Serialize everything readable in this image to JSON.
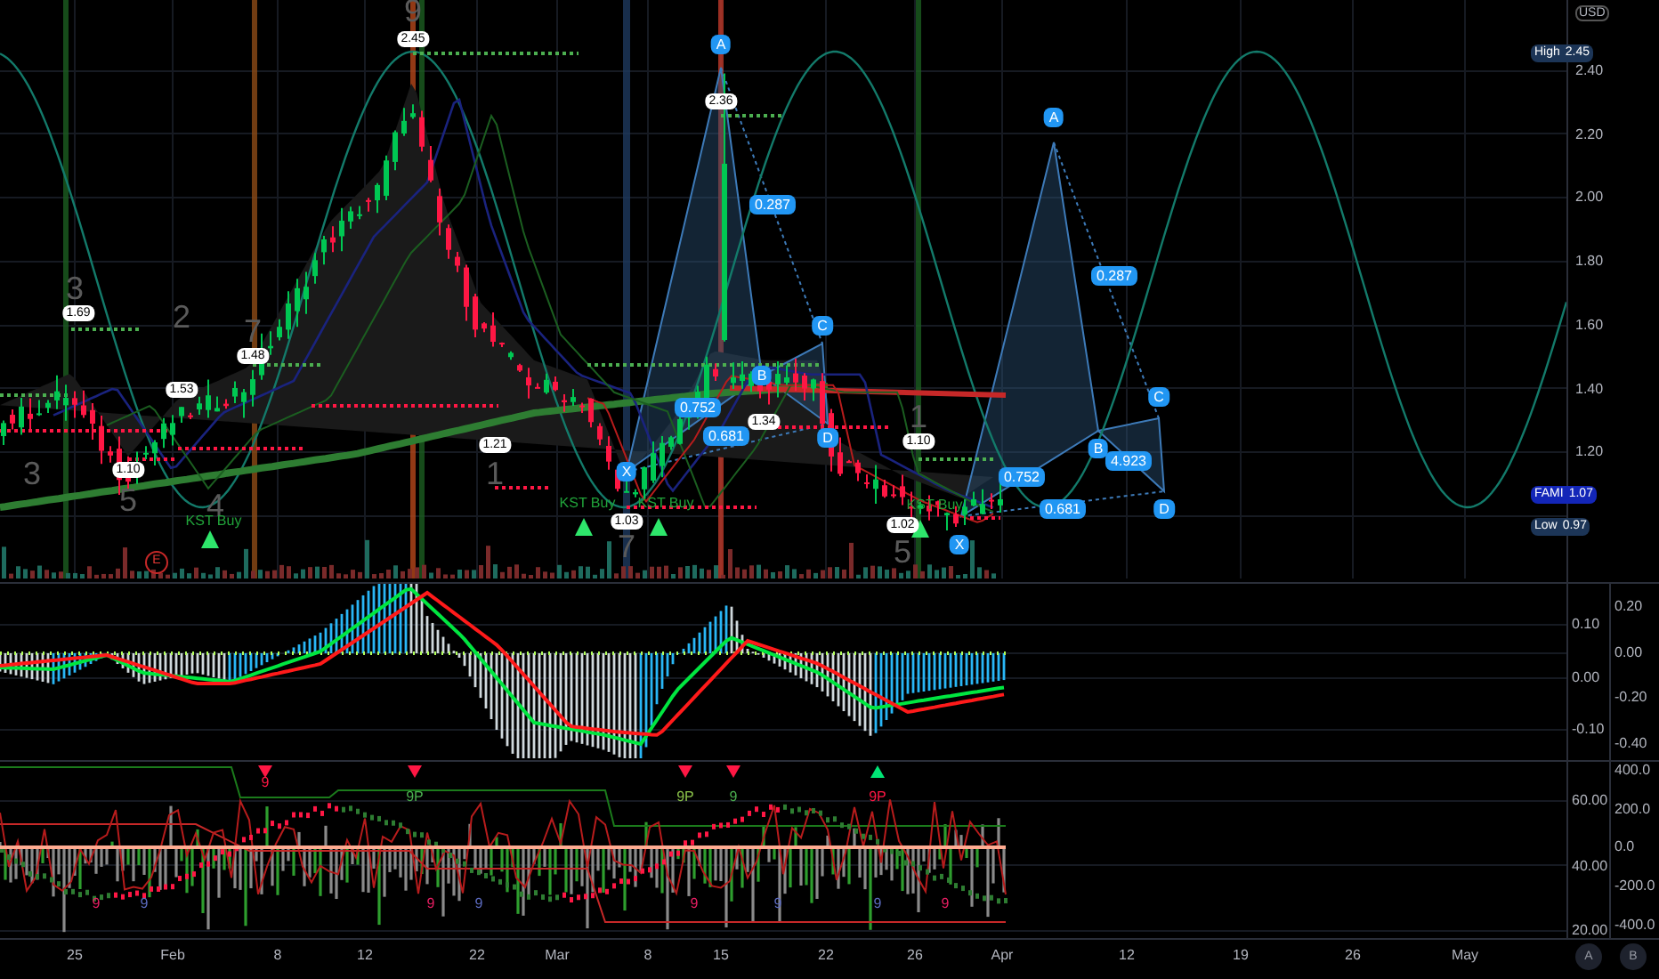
{
  "price_axis": {
    "currency": "USD",
    "ticks": [
      "2.40",
      "2.20",
      "2.00",
      "1.80",
      "1.60",
      "1.40",
      "1.20"
    ],
    "tags": [
      {
        "kind": "high",
        "label": "High",
        "value": "2.45"
      },
      {
        "kind": "last",
        "label": "FAMI",
        "value": "1.07"
      },
      {
        "kind": "low",
        "label": "Low",
        "value": "0.97"
      }
    ]
  },
  "main_annotations": [
    {
      "kind": "count",
      "text": "9"
    },
    {
      "kind": "price_tag",
      "text": "2.45"
    },
    {
      "kind": "count",
      "text": "3"
    },
    {
      "kind": "price_tag",
      "text": "1.69"
    },
    {
      "kind": "count",
      "text": "2"
    },
    {
      "kind": "price_tag",
      "text": "1.53"
    },
    {
      "kind": "count",
      "text": "7"
    },
    {
      "kind": "price_tag",
      "text": "1.48"
    },
    {
      "kind": "count",
      "text": "3"
    },
    {
      "kind": "price_tag",
      "text": "1.10"
    },
    {
      "kind": "count",
      "text": "5"
    },
    {
      "kind": "count",
      "text": "4"
    },
    {
      "kind": "signal",
      "text": "KST Buy"
    },
    {
      "kind": "price_tag",
      "text": "1.21"
    },
    {
      "kind": "count",
      "text": "1"
    },
    {
      "kind": "signal",
      "text": "KST Buy"
    },
    {
      "kind": "price_tag",
      "text": "1.03"
    },
    {
      "kind": "signal",
      "text": "KST Buy"
    },
    {
      "kind": "count",
      "text": "7"
    },
    {
      "kind": "pattern_point",
      "text": "A"
    },
    {
      "kind": "price_tag",
      "text": "2.36"
    },
    {
      "kind": "ratio",
      "text": "0.287"
    },
    {
      "kind": "pattern_point",
      "text": "C"
    },
    {
      "kind": "pattern_point",
      "text": "B"
    },
    {
      "kind": "ratio",
      "text": "0.752"
    },
    {
      "kind": "price_tag",
      "text": "1.34"
    },
    {
      "kind": "ratio",
      "text": "0.681"
    },
    {
      "kind": "pattern_point",
      "text": "D"
    },
    {
      "kind": "pattern_point",
      "text": "X"
    },
    {
      "kind": "count",
      "text": "1"
    },
    {
      "kind": "price_tag",
      "text": "1.10"
    },
    {
      "kind": "signal",
      "text": "KST Buy"
    },
    {
      "kind": "price_tag",
      "text": "1.02"
    },
    {
      "kind": "count",
      "text": "5"
    },
    {
      "kind": "pattern_point",
      "text": "X"
    },
    {
      "kind": "pattern_point",
      "text": "A"
    },
    {
      "kind": "ratio",
      "text": "0.287"
    },
    {
      "kind": "pattern_point",
      "text": "C"
    },
    {
      "kind": "pattern_point",
      "text": "B"
    },
    {
      "kind": "ratio",
      "text": "4.923"
    },
    {
      "kind": "ratio",
      "text": "0.752"
    },
    {
      "kind": "ratio",
      "text": "0.681"
    },
    {
      "kind": "pattern_point",
      "text": "D"
    },
    {
      "kind": "earnings",
      "text": "E"
    }
  ],
  "macd_pane": {
    "axis_a": [
      "0.10",
      "0.00",
      "-0.10"
    ],
    "axis_b": [
      "0.20",
      "0.00",
      "-0.20",
      "-0.40"
    ]
  },
  "oscillator_pane": {
    "axis_a": [
      "60.00",
      "40.00",
      "20.00"
    ],
    "axis_b": [
      "400.0",
      "200.0",
      "0.0",
      "-200.0",
      "-400.0"
    ],
    "annotations": [
      {
        "text": "9",
        "color": "#ff1744"
      },
      {
        "text": "9P",
        "color": "#4caf50"
      },
      {
        "text": "9P",
        "color": "#8bc34a"
      },
      {
        "text": "9",
        "color": "#4caf50"
      },
      {
        "text": "9P",
        "color": "#ff1744"
      },
      {
        "text": "9",
        "color": "#e91e63"
      },
      {
        "text": "9",
        "color": "#5c6bc0"
      },
      {
        "text": "9",
        "color": "#e91e63"
      },
      {
        "text": "9",
        "color": "#5c6bc0"
      },
      {
        "text": "9",
        "color": "#e91e63"
      },
      {
        "text": "9",
        "color": "#5c6bc0"
      },
      {
        "text": "9",
        "color": "#5c6bc0"
      },
      {
        "text": "9",
        "color": "#e91e63"
      }
    ]
  },
  "time_axis": [
    "25",
    "Feb",
    "8",
    "12",
    "22",
    "Mar",
    "8",
    "15",
    "22",
    "26",
    "Apr",
    "12",
    "19",
    "26",
    "May"
  ],
  "scale_buttons": [
    "A",
    "B"
  ]
}
